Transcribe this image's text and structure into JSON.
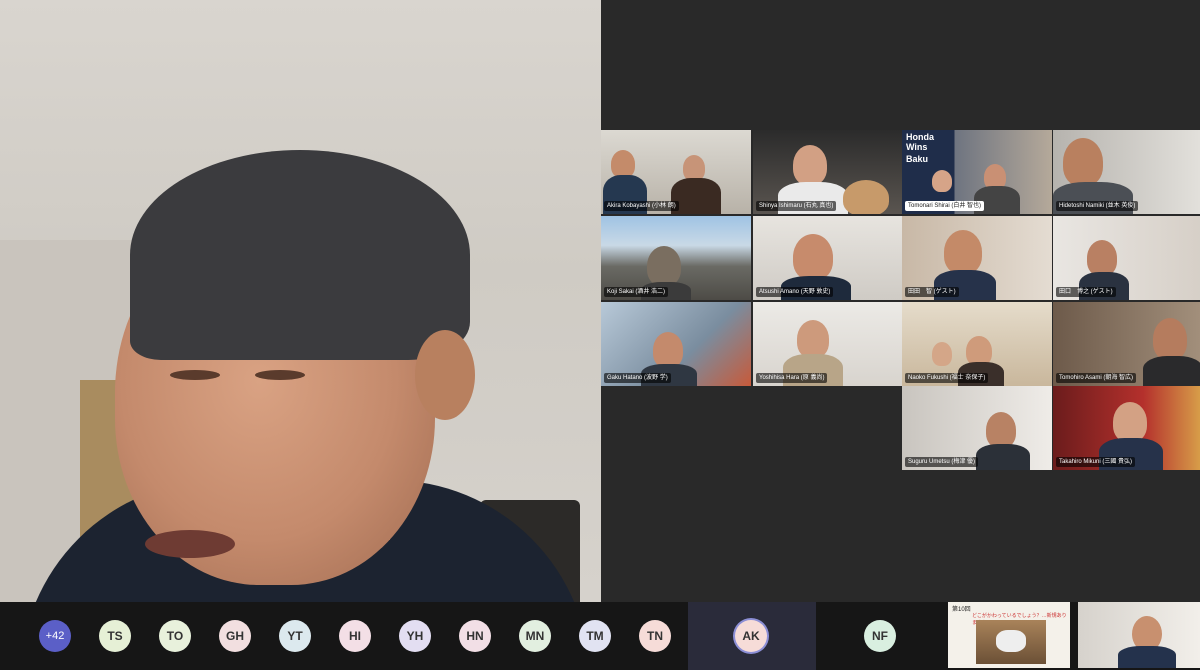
{
  "gallery": {
    "tiles": [
      {
        "name": "Akira Kobayashi (小林 朗)",
        "mic_icon": false
      },
      {
        "name": "Shinya Ishimaru (石丸 真也)",
        "mic_icon": true
      },
      {
        "name": "Tomonari Shirai (白井 智也)",
        "mic_icon": false
      },
      {
        "name": "Hidetoshi Namiki (並木 英俊)",
        "mic_icon": false
      },
      {
        "name": "Koji Sakai (酒井 浩二)",
        "mic_icon": true
      },
      {
        "name": "Atsushi Amano (天野 敦史)",
        "mic_icon": false
      },
      {
        "name": "田田　智 (ゲスト)",
        "mic_icon": false
      },
      {
        "name": "田口　博之 (ゲスト)",
        "mic_icon": true
      },
      {
        "name": "Gaku Hatano (波野 学)",
        "mic_icon": true
      },
      {
        "name": "Yoshihisa Hara (原 義尚)",
        "mic_icon": true
      },
      {
        "name": "Naoko Fukushi (福士 奈保子)",
        "mic_icon": true
      },
      {
        "name": "Tomohiro Asami (朝海 智広)",
        "mic_icon": false
      },
      {
        "name": "Suguru Umetsu (梅津 優)",
        "mic_icon": true
      },
      {
        "name": "Takahiro Mikuni (三國 貴弘)",
        "mic_icon": true
      }
    ],
    "book_title": "Honda Wins",
    "book_sub": "Baku"
  },
  "participants": {
    "more_count": "+42",
    "initials": [
      "TS",
      "TO",
      "GH",
      "YT",
      "HI",
      "YH",
      "HN",
      "MN",
      "TM",
      "TN"
    ],
    "active": "AK",
    "extra": "NF",
    "avatar_colors": [
      "#e6f0d6",
      "#e8f1dc",
      "#f2dfe0",
      "#dce9ee",
      "#f3dfe6",
      "#e3def2",
      "#f2dfe6",
      "#e2efe0",
      "#e1e3f2",
      "#f6dcd8"
    ],
    "active_color": "#f6dcd8",
    "extra_color": "#d9efe0"
  },
  "thumbnail": {
    "slide_title": "第10回",
    "slide_sub": "どこがかわっているでしょう？…新規ありますか"
  }
}
